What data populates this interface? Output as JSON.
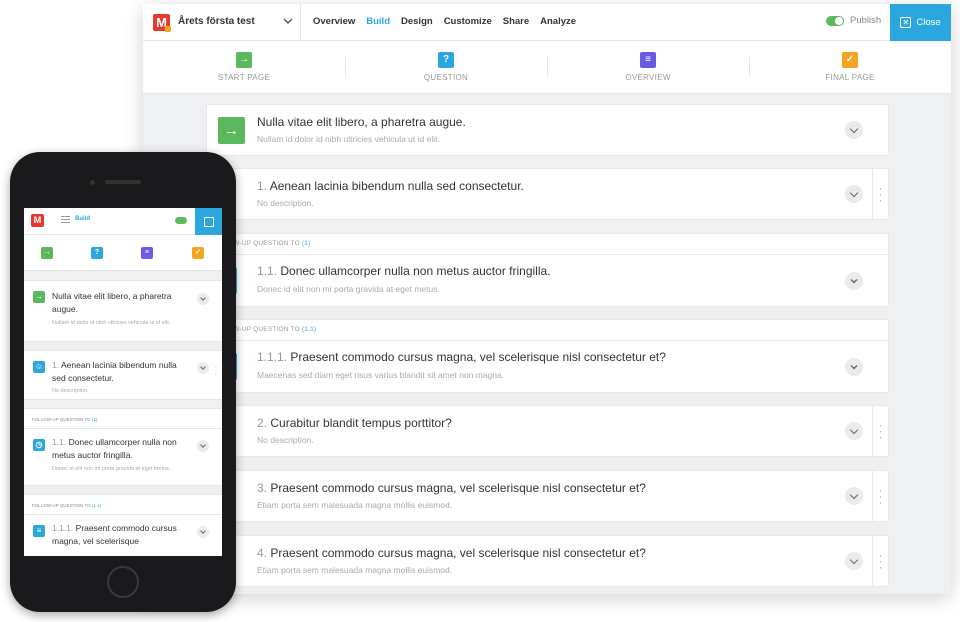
{
  "colors": {
    "accent": "#2ba7de",
    "green": "#5cb85c",
    "purple": "#6b5ce7",
    "orange": "#f3a521",
    "logo_red": "#e8372c"
  },
  "header": {
    "survey_title": "Årets första test",
    "nav": [
      "Overview",
      "Build",
      "Design",
      "Customize",
      "Share",
      "Analyze"
    ],
    "active_nav": "Build",
    "publish_label": "Publish",
    "close_label": "Close"
  },
  "steps": [
    {
      "label": "START PAGE",
      "icon": "arrow-right-icon",
      "glyph": "→",
      "color": "#5cb85c"
    },
    {
      "label": "QUESTION",
      "icon": "question-icon",
      "glyph": "?",
      "color": "#2ba7de"
    },
    {
      "label": "OVERVIEW",
      "icon": "list-icon",
      "glyph": "≡",
      "color": "#6b5ce7"
    },
    {
      "label": "FINAL PAGE",
      "icon": "check-icon",
      "glyph": "✓",
      "color": "#f3a521"
    }
  ],
  "start_card": {
    "title": "Nulla vitae elit libero, a pharetra augue.",
    "desc": "Nullam id dolor id nibh ultricies vehicula ut id elit."
  },
  "questions": [
    {
      "num": "1.",
      "title": "Aenean lacinia bibendum nulla sed consectetur.",
      "desc": "No description."
    },
    {
      "num": "1.1.",
      "title": "Donec ullamcorper nulla non metus auctor fringilla.",
      "desc": "Donec id elit non mi porta gravida at eget metus."
    },
    {
      "num": "1.1.1.",
      "title": "Praesent commodo cursus magna, vel scelerisque nisl consectetur et?",
      "desc": "Maecenas sed diam eget risus varius blandit sit amet non magna."
    },
    {
      "num": "2.",
      "title": "Curabitur blandit tempus porttitor?",
      "desc": "No description."
    },
    {
      "num": "3.",
      "title": "Praesent commodo cursus magna, vel scelerisque nisl consectetur et?",
      "desc": "Etiam porta sem malesuada magna mollis euismod."
    },
    {
      "num": "4.",
      "title": "Praesent commodo cursus magna, vel scelerisque nisl consectetur et?",
      "desc": "Etiam porta sem malesuada magna mollis euismod."
    }
  ],
  "followups": [
    {
      "prefix": "OW-UP QUESTION TO",
      "ref": "(1)"
    },
    {
      "prefix": "OW-UP QUESTION TO",
      "ref": "(1.1)"
    }
  ],
  "mobile": {
    "build_label": "Build",
    "start_title": "Nulla vitae elit libero, a pharetra augue.",
    "start_desc": "Nullam id dolor id nibh ultricies vehicula ut id elit.",
    "q1_num": "1.",
    "q1_title": "Aenean lacinia bibendum nulla sed consectetur.",
    "q1_desc": "No description.",
    "fu1_prefix": "FOLLOW-UP QUESTION TO",
    "fu1_ref": "(1)",
    "q11_num": "1.1.",
    "q11_title": "Donec ullamcorper nulla non metus auctor fringilla.",
    "q11_desc": "Donec id elit non mi porta gravida at eget metus.",
    "fu2_prefix": "FOLLOW-UP QUESTION TO",
    "fu2_ref": "(1.1)",
    "q111_num": "1.1.1.",
    "q111_title": "Praesent commodo cursus magna, vel scelerisque"
  }
}
